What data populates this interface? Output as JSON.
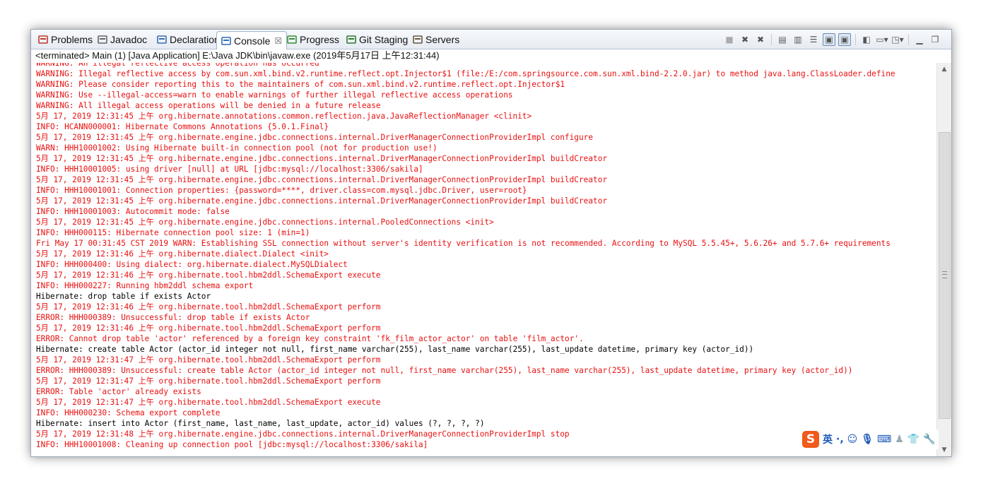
{
  "tabs": [
    {
      "label": "Problems",
      "icon": "problems-icon",
      "color": "#c0392b",
      "active": false
    },
    {
      "label": "Javadoc",
      "icon": "javadoc-icon",
      "color": "#666666",
      "active": false
    },
    {
      "label": "Declaration",
      "icon": "declaration-icon",
      "color": "#3b6fb6",
      "active": false
    },
    {
      "label": "Console",
      "icon": "console-icon",
      "color": "#2f6db5",
      "active": true,
      "close": "☒"
    },
    {
      "label": "Progress",
      "icon": "progress-icon",
      "color": "#3a8f3a",
      "active": false
    },
    {
      "label": "Git Staging",
      "icon": "git-staging-icon",
      "color": "#2f7d2f",
      "active": false
    },
    {
      "label": "Servers",
      "icon": "servers-icon",
      "color": "#6b5b3e",
      "active": false
    }
  ],
  "toolbar_icons": [
    "terminate-icon",
    "remove-launch-icon",
    "remove-all-terminated-icon",
    "clear-console-icon",
    "scroll-lock-icon",
    "word-wrap-icon",
    "show-on-stdout-icon",
    "show-on-stderr-icon",
    "pin-console-icon",
    "display-console-icon",
    "open-console-icon",
    "minimize-icon",
    "maximize-icon"
  ],
  "console_header": "<terminated> Main (1) [Java Application] E:\\Java JDK\\bin\\javaw.exe (2019年5月17日 上午12:31:44)",
  "console_lines": [
    {
      "text": "WARNING: An illegal reflective access operation has occurred",
      "stream": "err"
    },
    {
      "text": "WARNING: Illegal reflective access by com.sun.xml.bind.v2.runtime.reflect.opt.Injector$1 (file:/E:/com.springsource.com.sun.xml.bind-2.2.0.jar) to method java.lang.ClassLoader.define",
      "stream": "err"
    },
    {
      "text": "WARNING: Please consider reporting this to the maintainers of com.sun.xml.bind.v2.runtime.reflect.opt.Injector$1",
      "stream": "err"
    },
    {
      "text": "WARNING: Use --illegal-access=warn to enable warnings of further illegal reflective access operations",
      "stream": "err"
    },
    {
      "text": "WARNING: All illegal access operations will be denied in a future release",
      "stream": "err"
    },
    {
      "text": "5月 17, 2019 12:31:45 上午 org.hibernate.annotations.common.reflection.java.JavaReflectionManager <clinit>",
      "stream": "err"
    },
    {
      "text": "INFO: HCANN000001: Hibernate Commons Annotations {5.0.1.Final}",
      "stream": "err"
    },
    {
      "text": "5月 17, 2019 12:31:45 上午 org.hibernate.engine.jdbc.connections.internal.DriverManagerConnectionProviderImpl configure",
      "stream": "err"
    },
    {
      "text": "WARN: HHH10001002: Using Hibernate built-in connection pool (not for production use!)",
      "stream": "err"
    },
    {
      "text": "5月 17, 2019 12:31:45 上午 org.hibernate.engine.jdbc.connections.internal.DriverManagerConnectionProviderImpl buildCreator",
      "stream": "err"
    },
    {
      "text": "INFO: HHH10001005: using driver [null] at URL [jdbc:mysql://localhost:3306/sakila]",
      "stream": "err"
    },
    {
      "text": "5月 17, 2019 12:31:45 上午 org.hibernate.engine.jdbc.connections.internal.DriverManagerConnectionProviderImpl buildCreator",
      "stream": "err"
    },
    {
      "text": "INFO: HHH10001001: Connection properties: {password=****, driver.class=com.mysql.jdbc.Driver, user=root}",
      "stream": "err"
    },
    {
      "text": "5月 17, 2019 12:31:45 上午 org.hibernate.engine.jdbc.connections.internal.DriverManagerConnectionProviderImpl buildCreator",
      "stream": "err"
    },
    {
      "text": "INFO: HHH10001003: Autocommit mode: false",
      "stream": "err"
    },
    {
      "text": "5月 17, 2019 12:31:45 上午 org.hibernate.engine.jdbc.connections.internal.PooledConnections <init>",
      "stream": "err"
    },
    {
      "text": "INFO: HHH000115: Hibernate connection pool size: 1 (min=1)",
      "stream": "err"
    },
    {
      "text": "Fri May 17 00:31:45 CST 2019 WARN: Establishing SSL connection without server's identity verification is not recommended. According to MySQL 5.5.45+, 5.6.26+ and 5.7.6+ requirements",
      "stream": "err"
    },
    {
      "text": "5月 17, 2019 12:31:46 上午 org.hibernate.dialect.Dialect <init>",
      "stream": "err"
    },
    {
      "text": "INFO: HHH000400: Using dialect: org.hibernate.dialect.MySQLDialect",
      "stream": "err"
    },
    {
      "text": "5月 17, 2019 12:31:46 上午 org.hibernate.tool.hbm2ddl.SchemaExport execute",
      "stream": "err"
    },
    {
      "text": "INFO: HHH000227: Running hbm2ddl schema export",
      "stream": "err"
    },
    {
      "text": "Hibernate: drop table if exists Actor",
      "stream": "out"
    },
    {
      "text": "5月 17, 2019 12:31:46 上午 org.hibernate.tool.hbm2ddl.SchemaExport perform",
      "stream": "err"
    },
    {
      "text": "ERROR: HHH000389: Unsuccessful: drop table if exists Actor",
      "stream": "err"
    },
    {
      "text": "5月 17, 2019 12:31:46 上午 org.hibernate.tool.hbm2ddl.SchemaExport perform",
      "stream": "err"
    },
    {
      "text": "ERROR: Cannot drop table 'actor' referenced by a foreign key constraint 'fk_film_actor_actor' on table 'film_actor'.",
      "stream": "err"
    },
    {
      "text": "Hibernate: create table Actor (actor_id integer not null, first_name varchar(255), last_name varchar(255), last_update datetime, primary key (actor_id))",
      "stream": "out"
    },
    {
      "text": "5月 17, 2019 12:31:47 上午 org.hibernate.tool.hbm2ddl.SchemaExport perform",
      "stream": "err"
    },
    {
      "text": "ERROR: HHH000389: Unsuccessful: create table Actor (actor_id integer not null, first_name varchar(255), last_name varchar(255), last_update datetime, primary key (actor_id))",
      "stream": "err"
    },
    {
      "text": "5月 17, 2019 12:31:47 上午 org.hibernate.tool.hbm2ddl.SchemaExport perform",
      "stream": "err"
    },
    {
      "text": "ERROR: Table 'actor' already exists",
      "stream": "err"
    },
    {
      "text": "5月 17, 2019 12:31:47 上午 org.hibernate.tool.hbm2ddl.SchemaExport execute",
      "stream": "err"
    },
    {
      "text": "INFO: HHH000230: Schema export complete",
      "stream": "err"
    },
    {
      "text": "Hibernate: insert into Actor (first_name, last_name, last_update, actor_id) values (?, ?, ?, ?)",
      "stream": "out"
    },
    {
      "text": "5月 17, 2019 12:31:48 上午 org.hibernate.engine.jdbc.connections.internal.DriverManagerConnectionProviderImpl stop",
      "stream": "err"
    },
    {
      "text": "INFO: HHH10001008: Cleaning up connection pool [jdbc:mysql://localhost:3306/sakila]",
      "stream": "err"
    }
  ],
  "ime_toolbar": {
    "logo": "S",
    "lang": "英",
    "punct": "·,",
    "icons": [
      "emoji-icon",
      "microphone-icon",
      "keyboard-icon",
      "user-icon",
      "shirt-icon",
      "wrench-icon"
    ]
  },
  "colors": {
    "stderr": "#e81010",
    "stdout": "#000000",
    "accent": "#2f6db5"
  }
}
